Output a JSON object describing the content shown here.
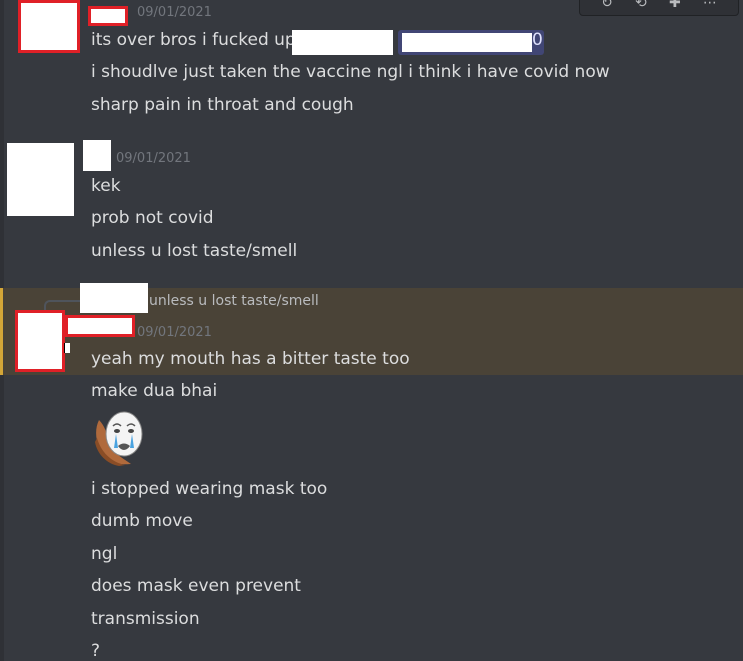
{
  "toolbar": {
    "icons": [
      "refresh-icon",
      "reply-icon",
      "add-reaction-icon",
      "more-icon"
    ]
  },
  "messages": [
    {
      "timestamp": "09/01/2021",
      "lines": [
        "its over bros i fucked up",
        "i shoudlve just taken the vaccine ngl i think i have covid now",
        "sharp pain in throat and cough"
      ],
      "mention_fragment": "0"
    },
    {
      "timestamp": "09/01/2021",
      "lines": [
        "kek",
        "prob not covid",
        "unless u lost taste/smell"
      ]
    },
    {
      "reply_preview": "unless u lost taste/smell",
      "timestamp": "09/01/2021",
      "lines": [
        "yeah my mouth has a bitter taste too",
        "make dua bhai",
        "i stopped wearing mask too",
        "dumb move",
        "ngl",
        "does mask even prevent",
        "transmission",
        "?"
      ],
      "emoji": "crying-face-emoji"
    }
  ],
  "colors": {
    "background": "#36393f",
    "text": "#dcddde",
    "timestamp": "#72767d",
    "highlight": "#4a4337",
    "highlight_border": "#d4a637",
    "mention": "#414675",
    "redaction_red": "#e02027"
  }
}
